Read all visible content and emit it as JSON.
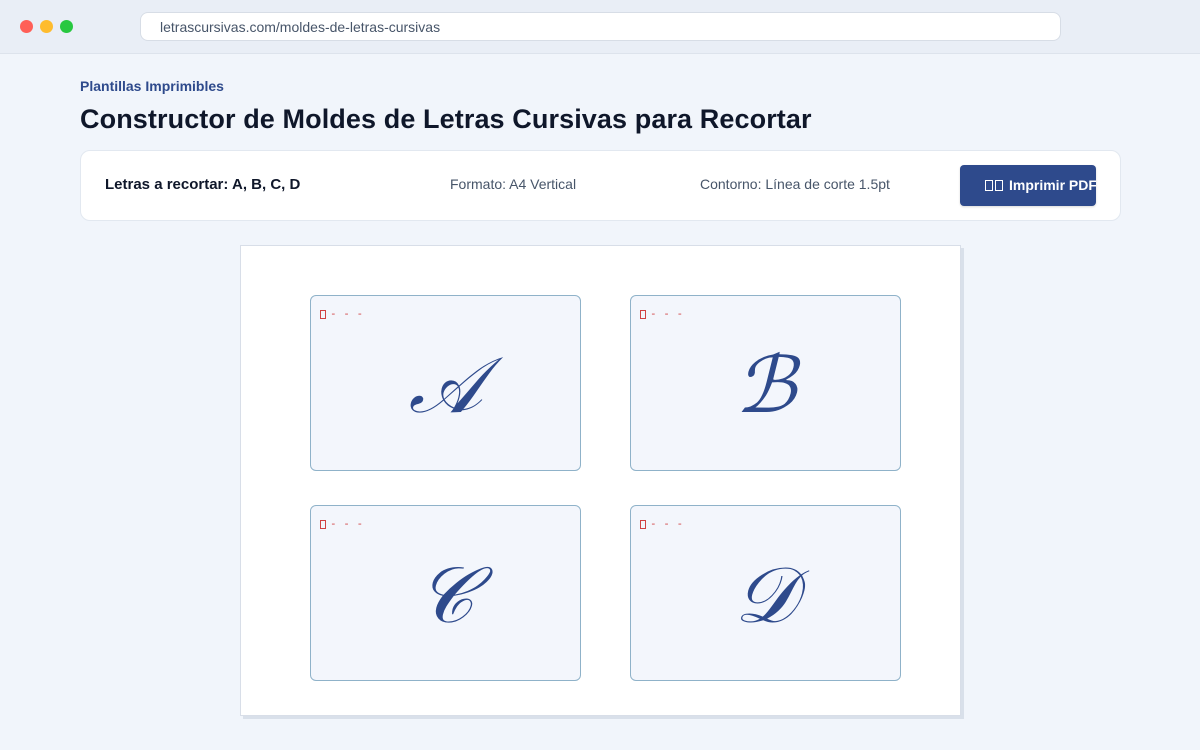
{
  "browser": {
    "url": "letrascursivas.com/moldes-de-letras-cursivas"
  },
  "header": {
    "kicker": "Plantillas Imprimibles",
    "title": "Constructor de Moldes de Letras Cursivas para Recortar"
  },
  "toolbar": {
    "letters_label": "Letras a recortar: A, B, C, D",
    "format_label": "Formato: A4 Vertical",
    "outline_label": "Contorno: Línea de corte 1.5pt",
    "print_button": "Imprimir PDF",
    "print_icon": "printer-icon"
  },
  "sheet": {
    "cut_mark": "- - -",
    "cut_icon": "scissors-icon",
    "tiles": [
      {
        "letter": "𝒜"
      },
      {
        "letter": "ℬ"
      },
      {
        "letter": "𝒞"
      },
      {
        "letter": "𝒟"
      }
    ]
  },
  "colors": {
    "accent": "#2e4a8c",
    "cut_line": "#d14343",
    "tile_border": "#8fb2c9",
    "background": "#f1f5fb"
  }
}
